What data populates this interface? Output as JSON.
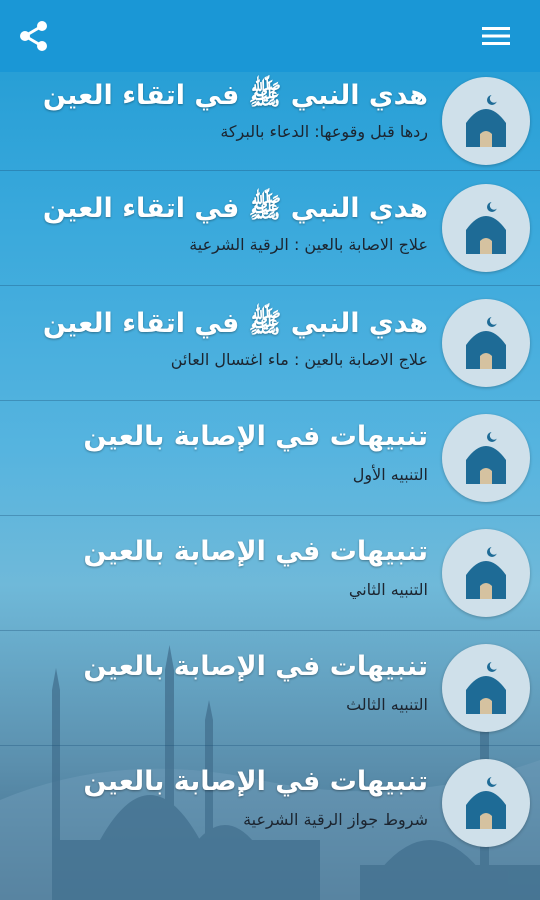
{
  "header": {
    "share_icon": "share-icon",
    "menu_icon": "hamburger-menu-icon",
    "background_color": "#1a97d6"
  },
  "items": [
    {
      "title": "هدي النبي ﷺ في اتقاء العين",
      "subtitle": "ردها قبل وقوعها: الدعاء بالبركة",
      "icon": "mosque-icon"
    },
    {
      "title": "هدي النبي ﷺ في اتقاء العين",
      "subtitle": "علاج الاصابة بالعين : الرقية الشرعية",
      "icon": "mosque-icon"
    },
    {
      "title": "هدي النبي ﷺ في اتقاء العين",
      "subtitle": "علاج الاصابة بالعين : ماء اغتسال العائن",
      "icon": "mosque-icon"
    },
    {
      "title": "تنبيهات في الإصابة بالعين",
      "subtitle": "التنبيه الأول",
      "icon": "mosque-icon"
    },
    {
      "title": "تنبيهات في الإصابة بالعين",
      "subtitle": "التنبيه الثاني",
      "icon": "mosque-icon"
    },
    {
      "title": "تنبيهات في الإصابة بالعين",
      "subtitle": "التنبيه الثالث",
      "icon": "mosque-icon"
    },
    {
      "title": "تنبيهات في الإصابة بالعين",
      "subtitle": "شروط جواز الرقية الشرعية",
      "icon": "mosque-icon"
    }
  ]
}
